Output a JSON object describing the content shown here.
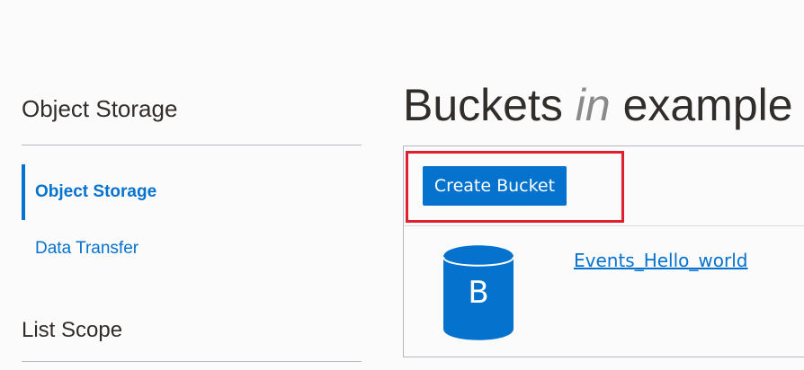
{
  "sidebar": {
    "title": "Object Storage",
    "items": [
      {
        "label": "Object Storage",
        "active": true
      },
      {
        "label": "Data Transfer",
        "active": false
      }
    ],
    "list_scope_title": "List Scope"
  },
  "main": {
    "title_prefix": "Buckets ",
    "title_in": "in",
    "title_suffix": " example",
    "create_button_label": "Create Bucket",
    "buckets": [
      {
        "icon_letter": "B",
        "name": "Events_Hello_world"
      }
    ]
  },
  "colors": {
    "accent": "#0572ce",
    "highlight": "#e0202c",
    "text": "#312d2a"
  }
}
